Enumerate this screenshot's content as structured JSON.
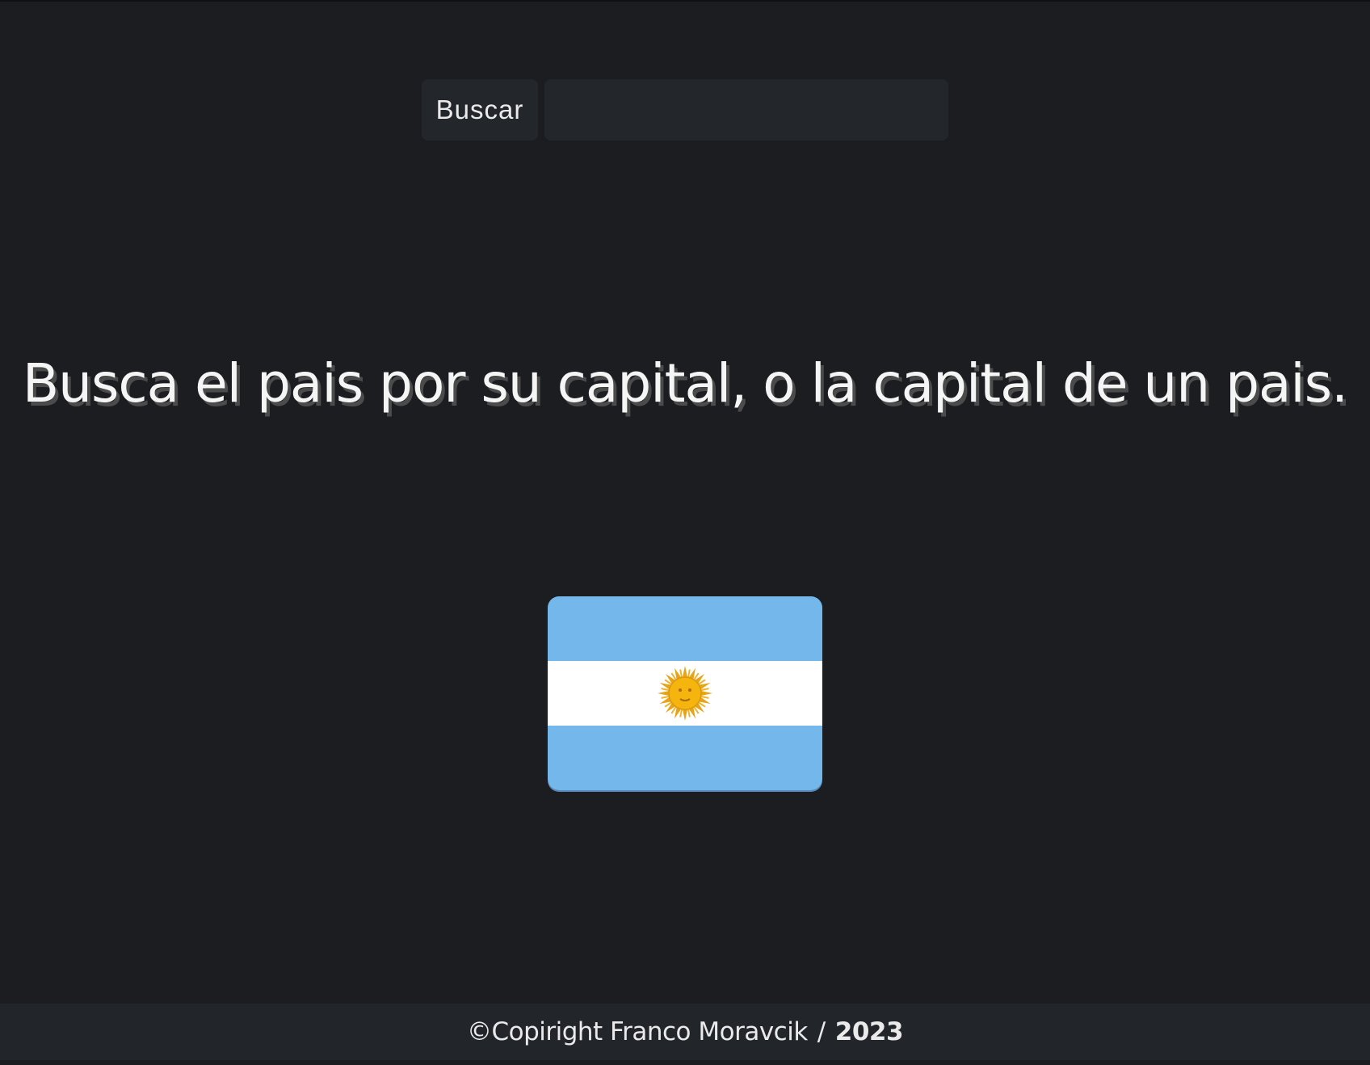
{
  "search": {
    "button_label": "Buscar",
    "input_value": "",
    "placeholder": ""
  },
  "main": {
    "headline": "Busca el pais por su capital, o la capital de un pais.",
    "flag_icon": "argentina-flag-icon"
  },
  "footer": {
    "copyright": "©Copiright Franco Moravcik",
    "separator": "/",
    "year": "2023"
  },
  "colors": {
    "background": "#1c1d21",
    "surface": "#23262a",
    "flag_blue": "#74b7ea",
    "flag_white": "#ffffff",
    "sun": "#f6b40e"
  }
}
